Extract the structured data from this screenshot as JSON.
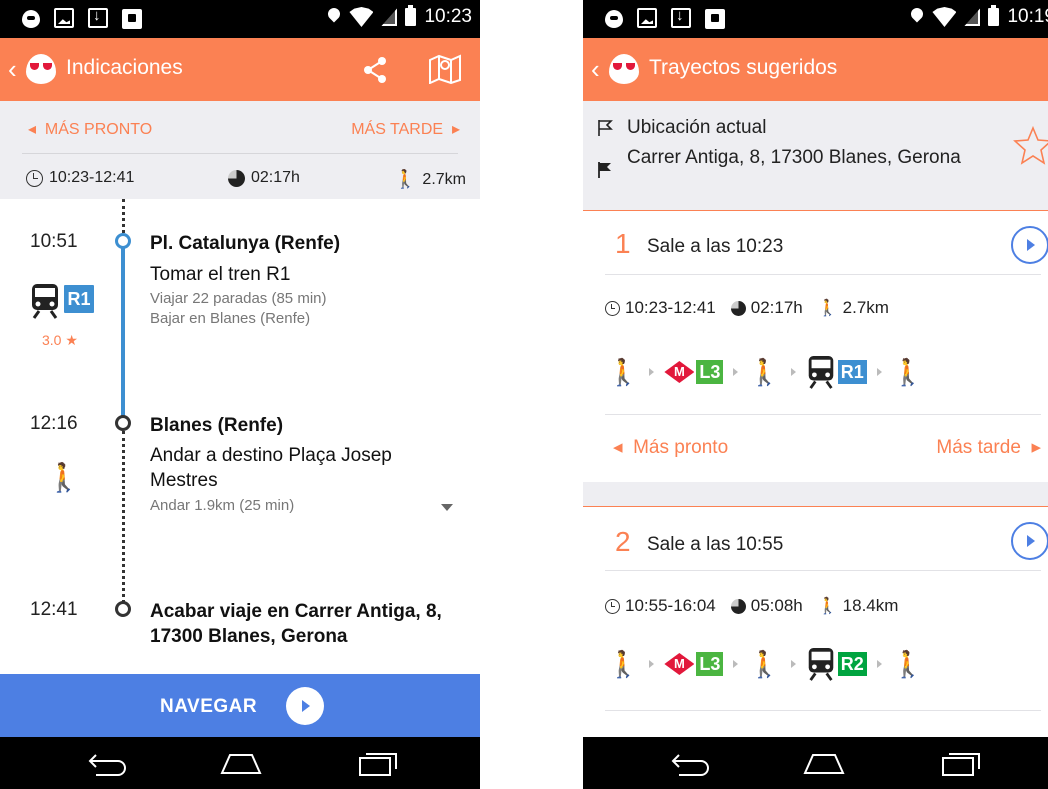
{
  "left": {
    "status_time": "10:23",
    "title": "Indicaciones",
    "earlier": "MÁS PRONTO",
    "later": "MÁS TARDE",
    "time_range": "10:23-12:41",
    "duration": "02:17h",
    "walk_distance": "2.7km",
    "steps": [
      {
        "time": "10:51",
        "title": "Pl. Catalunya (Renfe)",
        "action": "Tomar el tren R1",
        "detail1": "Viajar 22 paradas (85 min)",
        "detail2": "Bajar en Blanes (Renfe)",
        "line": "R1",
        "rating": "3.0"
      },
      {
        "time": "12:16",
        "title": "Blanes (Renfe)",
        "action": "Andar a destino Plaça Josep Mestres",
        "detail1": "Andar 1.9km (25 min)"
      },
      {
        "time": "12:41",
        "title": "Acabar viaje en Carrer Antiga, 8, 17300 Blanes, Gerona"
      }
    ],
    "navigate": "NAVEGAR"
  },
  "right": {
    "status_time": "10:19",
    "title": "Trayectos sugeridos",
    "origin": "Ubicación actual",
    "destination": "Carrer Antiga, 8, 17300 Blanes, Gerona",
    "routes": [
      {
        "number": "1",
        "departure": "Sale a las 10:23",
        "time_range": "10:23-12:41",
        "duration": "02:17h",
        "walk_distance": "2.7km",
        "metro_label": "M",
        "metro_line": "L3",
        "train_line": "R1",
        "earlier": "Más pronto",
        "later": "Más tarde"
      },
      {
        "number": "2",
        "departure": "Sale a las 10:55",
        "time_range": "10:55-16:04",
        "duration": "05:08h",
        "walk_distance": "18.4km",
        "metro_label": "M",
        "metro_line": "L3",
        "train_line": "R2"
      }
    ]
  },
  "colors": {
    "accent_orange": "#fb8153",
    "nav_blue": "#4d7fe3",
    "line_r1": "#3d8fd1",
    "line_r2": "#00a440",
    "line_l3": "#4bb541",
    "metro_red": "#e2183b"
  },
  "icons": [
    "back-chevron-icon",
    "app-logo-icon",
    "share-icon",
    "map-icon",
    "clock-icon",
    "duration-pie-icon",
    "walk-icon",
    "train-icon",
    "star-icon",
    "flag-outline-icon",
    "flag-filled-icon",
    "play-circle-icon",
    "metro-diamond-icon"
  ]
}
